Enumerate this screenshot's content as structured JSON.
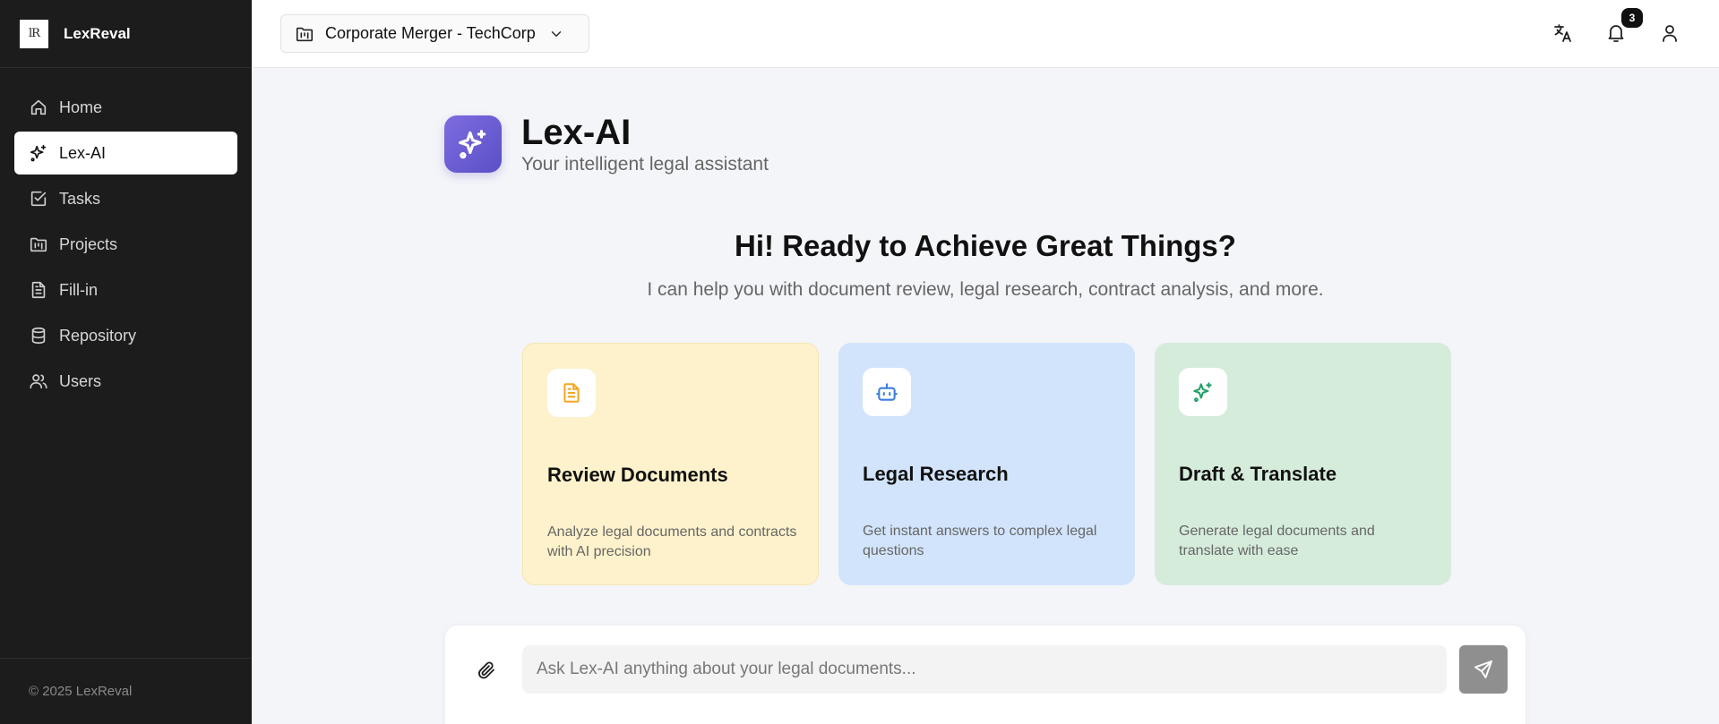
{
  "app": {
    "logo_text": "lR",
    "name": "LexReval"
  },
  "sidebar": {
    "items": [
      {
        "label": "Home",
        "icon": "home-icon"
      },
      {
        "label": "Lex-AI",
        "icon": "sparkles-icon",
        "active": true
      },
      {
        "label": "Tasks",
        "icon": "checkbox-icon"
      },
      {
        "label": "Projects",
        "icon": "folder-kanban-icon"
      },
      {
        "label": "Fill-in",
        "icon": "file-text-icon"
      },
      {
        "label": "Repository",
        "icon": "database-icon"
      },
      {
        "label": "Users",
        "icon": "users-icon"
      }
    ],
    "footer": "© 2025 LexReval"
  },
  "topbar": {
    "project_name": "Corporate Merger - TechCorp",
    "notification_count": "3",
    "icons": [
      "translate-icon",
      "bell-icon",
      "user-icon"
    ]
  },
  "header": {
    "title": "Lex-AI",
    "subtitle": "Your intelligent legal assistant"
  },
  "main": {
    "greeting": "Hi! Ready to Achieve Great Things?",
    "greeting_sub": "I can help you with document review, legal research, contract analysis, and more.",
    "cards": [
      {
        "title": "Review Documents",
        "description": "Analyze legal documents and contracts with AI precision",
        "icon": "document-icon",
        "color": "#f5a623"
      },
      {
        "title": "Legal Research",
        "description": "Get instant answers to complex legal questions",
        "icon": "bot-icon",
        "color": "#3b7ddd"
      },
      {
        "title": "Draft & Translate",
        "description": "Generate legal documents and translate with ease",
        "icon": "sparkles-icon",
        "color": "#22a06b"
      }
    ]
  },
  "chat": {
    "placeholder": "Ask Lex-AI anything about your legal documents...",
    "value": ""
  },
  "colors": {
    "sidebar_bg": "#1c1c1c",
    "accent": "#6a5cd6",
    "send_button": "#8f8f8f"
  }
}
